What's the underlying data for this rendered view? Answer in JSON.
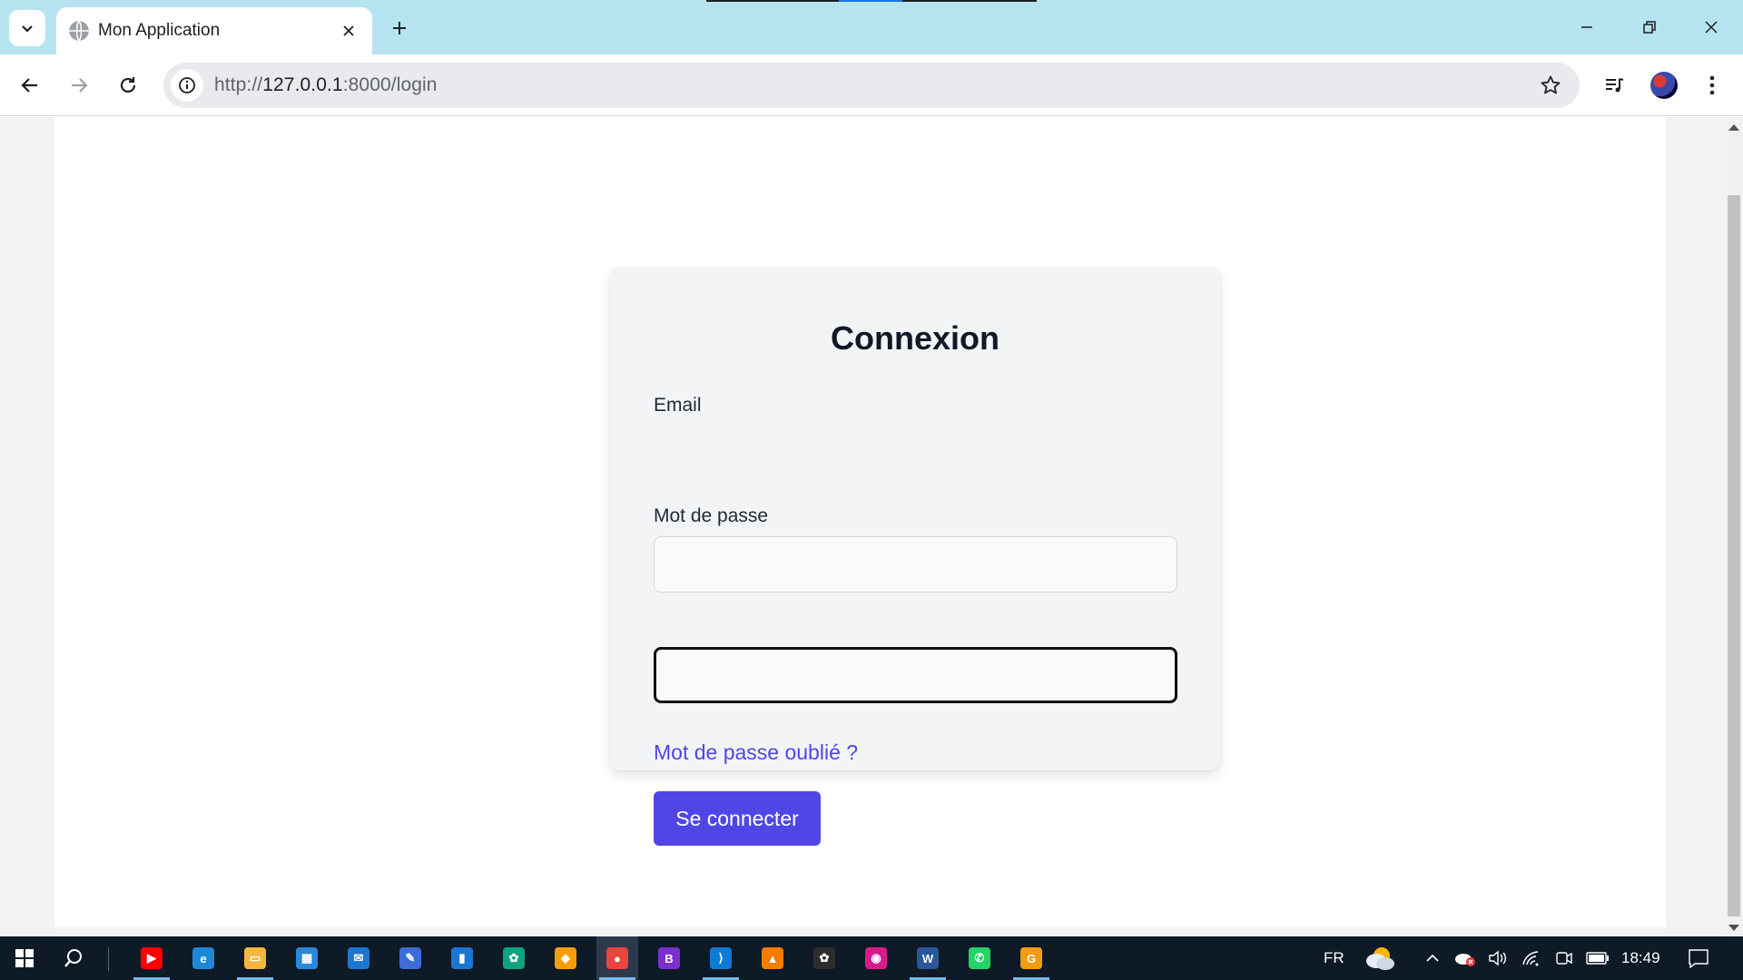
{
  "browser": {
    "tab": {
      "title": "Mon Application"
    },
    "url": {
      "scheme": "http://",
      "host": "127.0.0.1",
      "rest": ":8000/login"
    }
  },
  "login": {
    "title": "Connexion",
    "email_label": "Email",
    "email_value": "",
    "password_label": "Mot de passe",
    "password_value": "",
    "forgot_link": "Mot de passe oublié ?",
    "submit_label": "Se connecter"
  },
  "taskbar": {
    "language": "FR",
    "time": "18:49",
    "apps": [
      {
        "name": "youtube",
        "color": "#ff0000",
        "glyph": "▶"
      },
      {
        "name": "edge",
        "color": "#1e88d6",
        "glyph": "e"
      },
      {
        "name": "file-explorer",
        "color": "#f4b73e",
        "glyph": "▭"
      },
      {
        "name": "microsoft-store",
        "color": "#2b88d8",
        "glyph": "▦"
      },
      {
        "name": "mail",
        "color": "#1c76d2",
        "glyph": "✉"
      },
      {
        "name": "pen-app",
        "color": "#3d6dd6",
        "glyph": "✎"
      },
      {
        "name": "blue-app",
        "color": "#1976d2",
        "glyph": "▮"
      },
      {
        "name": "chatgpt",
        "color": "#10a37f",
        "glyph": "✿"
      },
      {
        "name": "shield-app",
        "color": "#f59e0b",
        "glyph": "◆"
      },
      {
        "name": "chrome",
        "color": "#e8453c",
        "glyph": "●"
      },
      {
        "name": "bootstrap-app",
        "color": "#7b2fd0",
        "glyph": "B"
      },
      {
        "name": "vscode",
        "color": "#0e7bd6",
        "glyph": "⟩"
      },
      {
        "name": "triangle-app",
        "color": "#f57c00",
        "glyph": "▲"
      },
      {
        "name": "openai",
        "color": "#2d2d2d",
        "glyph": "✿"
      },
      {
        "name": "tool-app",
        "color": "#d81b8c",
        "glyph": "◉"
      },
      {
        "name": "word",
        "color": "#2b579a",
        "glyph": "W"
      },
      {
        "name": "whatsapp",
        "color": "#25d366",
        "glyph": "✆"
      },
      {
        "name": "orange-app",
        "color": "#f39c12",
        "glyph": "G"
      }
    ]
  }
}
